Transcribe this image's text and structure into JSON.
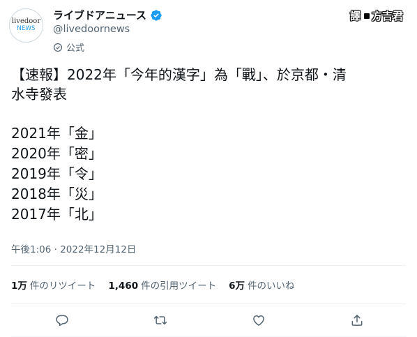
{
  "account": {
    "display_name": "ライブドアニュース",
    "handle": "@livedoornews",
    "official_label": "公式",
    "avatar_text_1": "livedoor",
    "avatar_text_2": "NEWS",
    "verified_color": "#1d9bf0"
  },
  "translator": {
    "tag": "譯",
    "name": "方吉君"
  },
  "tweet": {
    "lines": [
      "【速報】2022年「今年的漢字」為「戰」、於京都・清",
      "水寺發表"
    ],
    "list": [
      "2021年「金」",
      "2020年「密」",
      "2019年「令」",
      "2018年「災」",
      "2017年「北」"
    ],
    "timestamp": "午後1:06 · 2022年12月12日"
  },
  "stats": {
    "retweets_count": "1万",
    "retweets_label": "件のリツイート",
    "quotes_count": "1,460",
    "quotes_label": "件の引用ツイート",
    "likes_count": "6万",
    "likes_label": "件のいいね"
  },
  "actions": {
    "icons": [
      "reply-icon",
      "retweet-icon",
      "like-icon",
      "share-icon"
    ]
  }
}
